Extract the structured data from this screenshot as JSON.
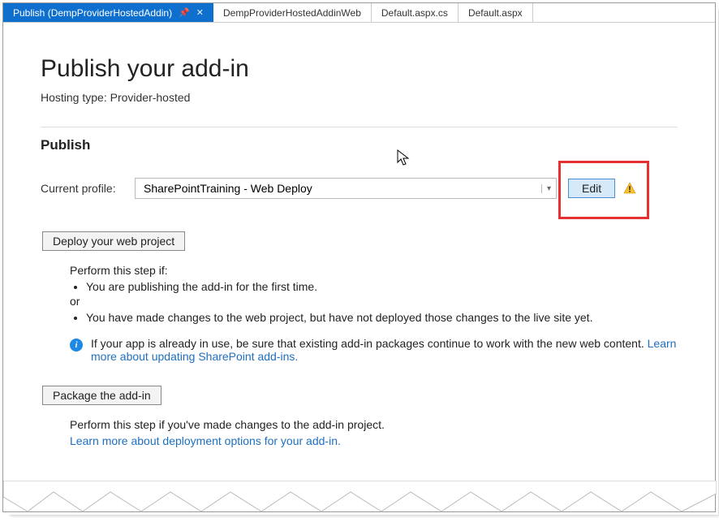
{
  "tabs": [
    {
      "label": "Publish (DempProviderHostedAddin)",
      "active": true,
      "pinned": true,
      "closable": true
    },
    {
      "label": "DempProviderHostedAddinWeb",
      "active": false
    },
    {
      "label": "Default.aspx.cs",
      "active": false
    },
    {
      "label": "Default.aspx",
      "active": false
    }
  ],
  "page": {
    "title": "Publish your add-in",
    "hosting_label": "Hosting type: Provider-hosted",
    "section_heading": "Publish"
  },
  "profile": {
    "label": "Current profile:",
    "selected": "SharePointTraining - Web Deploy",
    "edit_label": "Edit"
  },
  "deploy": {
    "button": "Deploy your web project",
    "intro": "Perform this step if:",
    "cond1": "You are publishing the add-in for the first time.",
    "or": "or",
    "cond2": "You have made changes to the web project, but have not deployed those changes to the live site yet.",
    "info1": "If your app is already in use, be sure that existing add-in packages continue to work with the new web content. ",
    "info_link": "Learn more about updating SharePoint add-ins."
  },
  "package": {
    "button": "Package the add-in",
    "intro": "Perform this step if you've made changes to the add-in project.",
    "link": "Learn more about deployment options for your add-in."
  }
}
